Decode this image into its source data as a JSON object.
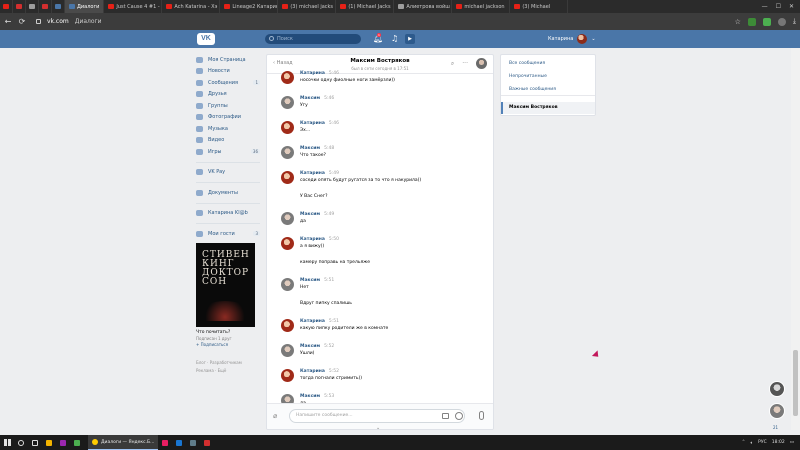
{
  "browser": {
    "tabs": [
      {
        "type": "small",
        "fav": "yt",
        "label": ""
      },
      {
        "type": "small",
        "fav": "red",
        "label": ""
      },
      {
        "type": "small",
        "fav": "gray",
        "label": ""
      },
      {
        "type": "small",
        "fav": "red",
        "label": ""
      },
      {
        "type": "small",
        "fav": "vk",
        "label": ""
      },
      {
        "type": "active",
        "fav": "vk",
        "label": "Диалоги"
      },
      {
        "type": "normal",
        "fav": "yt",
        "label": "Just Cause 4 #1 -"
      },
      {
        "type": "normal",
        "fav": "yt",
        "label": "Ach Katarina - Хэ"
      },
      {
        "type": "normal",
        "fav": "yt",
        "label": "Lineage2 Катарин"
      },
      {
        "type": "normal",
        "fav": "yt",
        "label": "(3) michael jacks"
      },
      {
        "type": "normal",
        "fav": "yt",
        "label": "(1) Michael Jacks"
      },
      {
        "type": "normal",
        "fav": "gray",
        "label": "Алиетрова войш"
      },
      {
        "type": "normal",
        "fav": "yt",
        "label": "michael jackson"
      },
      {
        "type": "normal",
        "fav": "yt",
        "label": "(3) Michael"
      }
    ],
    "url": "vk.com",
    "page_title": "Диалоги"
  },
  "vk_header": {
    "logo": "VK",
    "search_placeholder": "Поиск",
    "notif_count": "1",
    "user_name": "Катарина"
  },
  "left_nav": {
    "items": [
      {
        "label": "Моя Страница",
        "count": ""
      },
      {
        "label": "Новости",
        "count": ""
      },
      {
        "label": "Сообщения",
        "count": "1"
      },
      {
        "label": "Друзья",
        "count": ""
      },
      {
        "label": "Группы",
        "count": ""
      },
      {
        "label": "Фотографии",
        "count": ""
      },
      {
        "label": "Музыка",
        "count": ""
      },
      {
        "label": "Видео",
        "count": ""
      },
      {
        "label": "Игры",
        "count": "36"
      }
    ],
    "items2": [
      {
        "label": "VK Pay",
        "count": ""
      }
    ],
    "items3": [
      {
        "label": "Документы",
        "count": ""
      }
    ],
    "items4": [
      {
        "label": "Катарина Kl@b",
        "count": ""
      }
    ],
    "items5": [
      {
        "label": "Мои гости",
        "count": "3"
      }
    ],
    "promo": {
      "cover_text": "СТИВЕН КИНГ ДОКТОР СОН",
      "title": "Что почитать?",
      "subscribers": "Подписан 1 друг",
      "subscribe": "+ Подписаться"
    },
    "footer": [
      "Блог · Разработчикам",
      "Реклама · Ещё"
    ]
  },
  "chat": {
    "back_label": "Назад",
    "name": "Максим Востряков",
    "status": "был в сети сегодня в 17:51",
    "messages": [
      {
        "author": "",
        "time": "",
        "lines": [
          "носочки одну фиолные ноги замёрзли))"
        ],
        "avatar": "kat",
        "partial": true
      },
      {
        "author": "Катарина",
        "time": "5:46",
        "lines": [
          "носочки одну фиолные ноги замёрзли))"
        ],
        "avatar": "kat"
      },
      {
        "author": "Максим",
        "time": "5:46",
        "lines": [
          "Угу"
        ],
        "avatar": "max"
      },
      {
        "author": "Катарина",
        "time": "5:46",
        "lines": [
          "Эх..."
        ],
        "avatar": "kat"
      },
      {
        "author": "Максим",
        "time": "5:48",
        "lines": [
          "Что такое?"
        ],
        "avatar": "max"
      },
      {
        "author": "Катарина",
        "time": "5:49",
        "lines": [
          "соседи опять будут ругатся за то что я накурила))",
          "",
          "У Вас Снег?"
        ],
        "avatar": "kat"
      },
      {
        "author": "Максим",
        "time": "5:49",
        "lines": [
          "да"
        ],
        "avatar": "max"
      },
      {
        "author": "Катарина",
        "time": "5:50",
        "lines": [
          "а я вижу))",
          "",
          "камеру поправь на трельяже"
        ],
        "avatar": "kat"
      },
      {
        "author": "Максим",
        "time": "5:51",
        "lines": [
          "Нет",
          "",
          "Вдруг пипку спалишь"
        ],
        "avatar": "max"
      },
      {
        "author": "Катарина",
        "time": "5:51",
        "lines": [
          "какую пипку родители же в комнате"
        ],
        "avatar": "kat"
      },
      {
        "author": "Максим",
        "time": "5:52",
        "lines": [
          "Ушли)"
        ],
        "avatar": "max"
      },
      {
        "author": "Катарина",
        "time": "5:52",
        "lines": [
          "тогда погнали стримить))"
        ],
        "avatar": "kat"
      },
      {
        "author": "Максим",
        "time": "5:53",
        "lines": [
          "да"
        ],
        "avatar": "max"
      }
    ],
    "composer_placeholder": "Напишите сообщение..."
  },
  "right_panel": {
    "items": [
      "Все сообщения",
      "Непрочитанные",
      "Важные сообщения"
    ],
    "active": "Максим Востряков"
  },
  "floating": {
    "counter": "21"
  },
  "taskbar": {
    "app_label": "Диалоги — Яндекс.Б...",
    "lang": "РУС",
    "time": "18:02"
  }
}
